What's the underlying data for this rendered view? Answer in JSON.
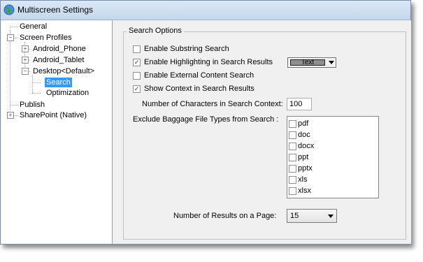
{
  "window": {
    "title": "Multiscreen Settings",
    "icon": "globe-icon"
  },
  "tree": {
    "items": [
      {
        "label": "General"
      },
      {
        "label": "Screen Profiles"
      },
      {
        "label": "Android_Phone"
      },
      {
        "label": "Android_Tablet"
      },
      {
        "label": "Desktop<Default>"
      },
      {
        "label": "Search"
      },
      {
        "label": "Optimization"
      },
      {
        "label": "Publish"
      },
      {
        "label": "SharePoint (Native)"
      }
    ],
    "selected": "Search"
  },
  "search_options": {
    "group_title": "Search Options",
    "enable_substring": {
      "label": "Enable Substring Search",
      "checked": false
    },
    "enable_highlighting": {
      "label": "Enable Highlighting in Search Results",
      "checked": true
    },
    "highlight_color": {
      "value": "Text"
    },
    "enable_external": {
      "label": "Enable External Content Search",
      "checked": false
    },
    "show_context": {
      "label": "Show Context in Search Results",
      "checked": true
    },
    "context_chars": {
      "label": "Number of Characters in Search Context:",
      "value": "100"
    },
    "exclude": {
      "label": "Exclude Baggage File Types from Search :",
      "types": [
        "pdf",
        "doc",
        "docx",
        "ppt",
        "pptx",
        "xls",
        "xlsx"
      ]
    },
    "results_per_page": {
      "label": "Number of Results on a Page:",
      "value": "15"
    }
  }
}
